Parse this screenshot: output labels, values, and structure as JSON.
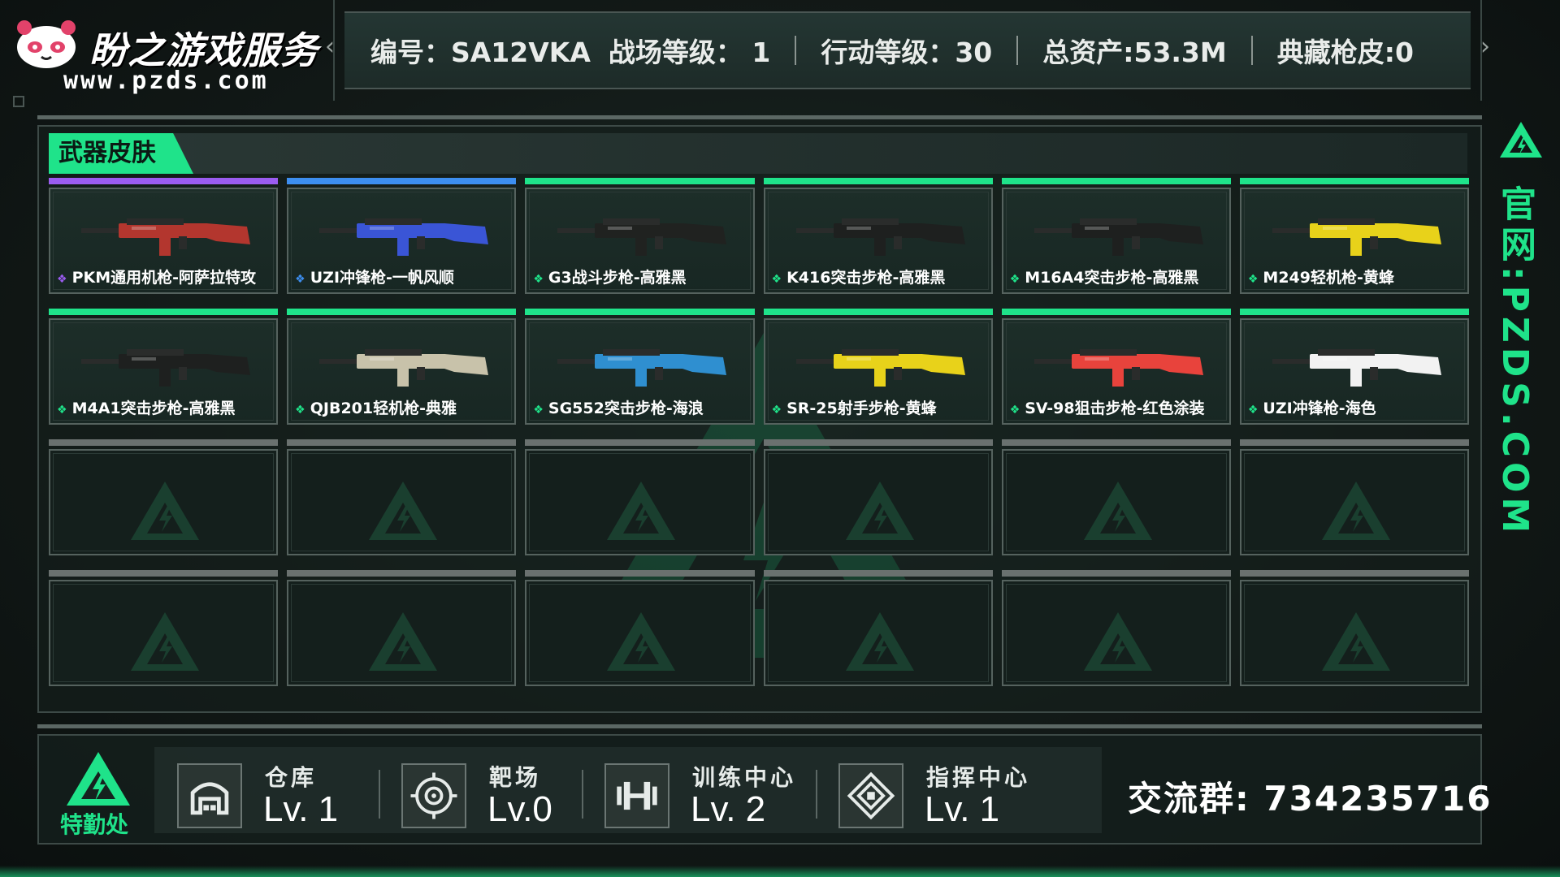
{
  "brand": {
    "name": "盼之游戏服务",
    "url": "www.pzds.com"
  },
  "header": {
    "id_label": "编号：SA12VKA",
    "battlefield_level": "战场等级： 1",
    "action_level": "行动等级：30",
    "total_assets": "总资产:53.3M",
    "collection_skins": "典藏枪皮:0"
  },
  "section": {
    "title": "武器皮肤"
  },
  "colors": {
    "accent": "#1fe38a",
    "rarity_purple": "#9b5cf0",
    "rarity_blue": "#3d8ef0",
    "rarity_green": "#1fe38a",
    "rarity_gray": "#6a716f"
  },
  "skins": [
    {
      "name": "PKM通用机枪-阿萨拉特攻",
      "rarity": "purple",
      "icon": "gun-pkm-icon",
      "tint": "#b3362e"
    },
    {
      "name": "UZI冲锋枪-一帆风顺",
      "rarity": "blue",
      "icon": "gun-uzi-icon",
      "tint": "#3a55d6"
    },
    {
      "name": "G3战斗步枪-高雅黑",
      "rarity": "green",
      "icon": "gun-g3-icon",
      "tint": "#202220"
    },
    {
      "name": "K416突击步枪-高雅黑",
      "rarity": "green",
      "icon": "gun-k416-icon",
      "tint": "#1e201f"
    },
    {
      "name": "M16A4突击步枪-高雅黑",
      "rarity": "green",
      "icon": "gun-m16a4-icon",
      "tint": "#1e201f"
    },
    {
      "name": "M249轻机枪-黄蜂",
      "rarity": "green",
      "icon": "gun-m249-icon",
      "tint": "#e8d21a"
    },
    {
      "name": "M4A1突击步枪-高雅黑",
      "rarity": "green",
      "icon": "gun-m4a1-icon",
      "tint": "#1e201f"
    },
    {
      "name": "QJB201轻机枪-典雅",
      "rarity": "green",
      "icon": "gun-qjb201-icon",
      "tint": "#c8c2aa"
    },
    {
      "name": "SG552突击步枪-海浪",
      "rarity": "green",
      "icon": "gun-sg552-icon",
      "tint": "#2f8fd0"
    },
    {
      "name": "SR-25射手步枪-黄蜂",
      "rarity": "green",
      "icon": "gun-sr25-icon",
      "tint": "#e8d21a"
    },
    {
      "name": "SV-98狙击步枪-红色涂装",
      "rarity": "green",
      "icon": "gun-sv98-icon",
      "tint": "#e8433c"
    },
    {
      "name": "UZI冲锋枪-海色",
      "rarity": "green",
      "icon": "gun-uzi-icon",
      "tint": "#f2f2f2"
    }
  ],
  "empty_slots": 12,
  "side": {
    "text": "官网:PZDS.COM"
  },
  "footer": {
    "department": "特勤处",
    "stats": [
      {
        "label": "仓库",
        "level": "Lv. 1",
        "icon": "warehouse-icon"
      },
      {
        "label": "靶场",
        "level": "Lv.0",
        "icon": "target-icon"
      },
      {
        "label": "训练中心",
        "level": "Lv. 2",
        "icon": "dumbbell-icon"
      },
      {
        "label": "指挥中心",
        "level": "Lv. 1",
        "icon": "command-icon"
      }
    ],
    "group": "交流群: 734235716"
  }
}
